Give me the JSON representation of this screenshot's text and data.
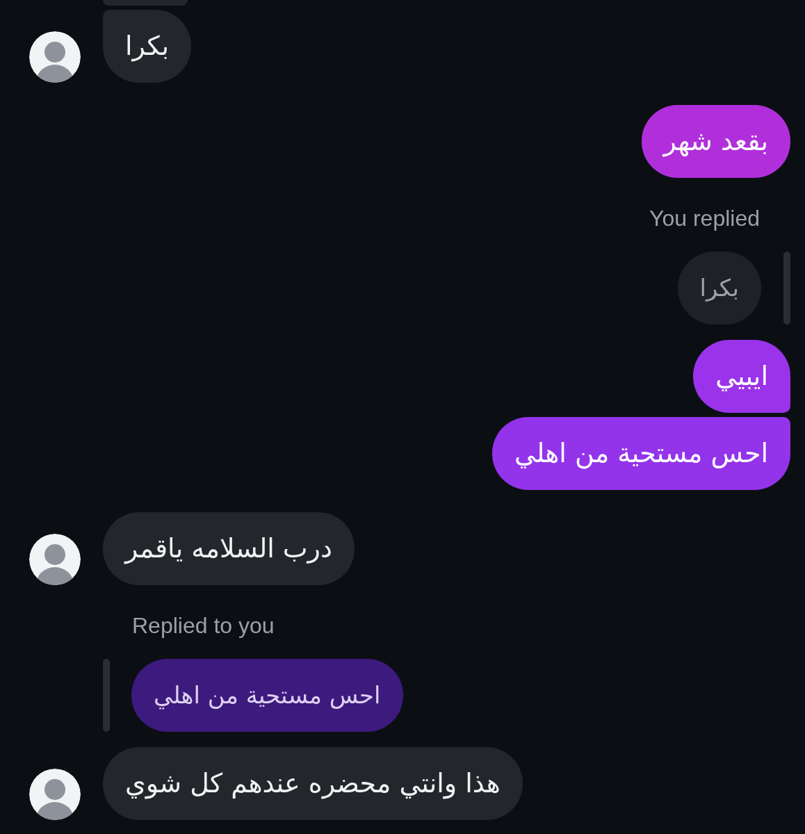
{
  "messages": [
    {
      "kind": "partial",
      "outgoing": false
    },
    {
      "kind": "text",
      "outgoing": false,
      "text": "بكرا",
      "avatar": true,
      "joined_above": true,
      "joined_below": false
    },
    {
      "kind": "text",
      "outgoing": true,
      "text": "بقعد شهر",
      "joined_above": false,
      "joined_below": false,
      "color": "#b02fdb"
    },
    {
      "kind": "text",
      "outgoing": true,
      "text": "ايبيي",
      "joined_above": false,
      "joined_below": true,
      "color": "#9a33e9",
      "reply": {
        "label": "You replied",
        "quotes_mine": false,
        "quoted_text": "بكرا"
      }
    },
    {
      "kind": "text",
      "outgoing": true,
      "text": "احس مستحية من اهلي",
      "joined_above": true,
      "joined_below": false,
      "color": "#9333ea"
    },
    {
      "kind": "text",
      "outgoing": false,
      "text": "درب السلامه ياقمر",
      "avatar": true,
      "joined_above": false,
      "joined_below": false
    },
    {
      "kind": "text",
      "outgoing": false,
      "text": "هذا وانتي محضره عندهم كل شوي",
      "avatar": true,
      "joined_above": false,
      "joined_below": false,
      "reply": {
        "label": "Replied to you",
        "quotes_mine": true,
        "quoted_text": "احس مستحية من اهلي"
      }
    }
  ]
}
